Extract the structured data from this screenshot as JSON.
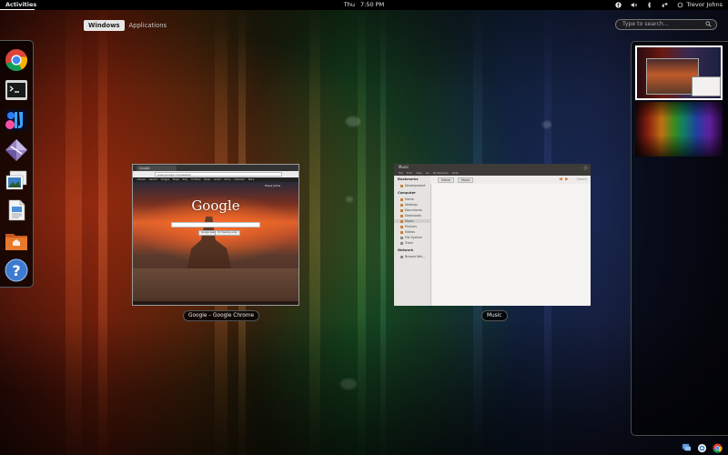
{
  "top_panel": {
    "activities_label": "Activities",
    "day": "Thu",
    "time": "7:50 PM",
    "user_name": "Trevor Johns",
    "tray_icons": [
      "accessibility-icon",
      "volume-icon",
      "bluetooth-icon",
      "network-icon",
      "user-status-icon"
    ]
  },
  "view_selector": {
    "windows_label": "Windows",
    "applications_label": "Applications",
    "active": "Windows"
  },
  "search": {
    "placeholder": "Type to search..."
  },
  "dash": {
    "apps": [
      {
        "name": "chrome-icon"
      },
      {
        "name": "terminal-icon"
      },
      {
        "name": "intellij-icon"
      },
      {
        "name": "diamond-app-icon"
      },
      {
        "name": "image-viewer-icon"
      },
      {
        "name": "document-viewer-icon"
      },
      {
        "name": "home-folder-icon"
      },
      {
        "name": "help-icon"
      }
    ]
  },
  "windows": {
    "chrome": {
      "caption": "Google – Google Chrome",
      "window_title": "Google – Google Chrome",
      "tab_label": "Google",
      "url": "www.google.com/webhp",
      "gbar_items": "+Trevor  Search  Images  Maps  Play  YouTube  News  Gmail  Drive  Calendar  More",
      "user_label": "Trevor Johns",
      "logo_text": "Google",
      "search_button": "Google Search",
      "lucky_button": "I'm Feeling Lucky"
    },
    "music": {
      "caption": "Music",
      "window_title": "Music",
      "menu_items": "File  Edit  View  Go  Bookmarks  Help",
      "sidebar": {
        "bookmarks_header": "Bookmarks",
        "bookmarks": [
          "Development"
        ],
        "computer_header": "Computer",
        "computer_items": [
          "Home",
          "Desktop",
          "Documents",
          "Downloads",
          "Music",
          "Pictures",
          "Videos",
          "File System",
          "Trash"
        ],
        "selected": "Music",
        "network_header": "Network",
        "network_items": [
          "Browse Net..."
        ]
      },
      "breadcrumbs": [
        "Home",
        "Music"
      ],
      "search_label": "Search"
    }
  },
  "colors": {
    "panel_bg": "#000000",
    "accent_orange": "#e07a30",
    "active_tab_bg": "#e6e6e6"
  },
  "message_tray": {
    "icons": [
      "chat-icon",
      "software-update-icon",
      "chrome-notification-icon"
    ]
  }
}
